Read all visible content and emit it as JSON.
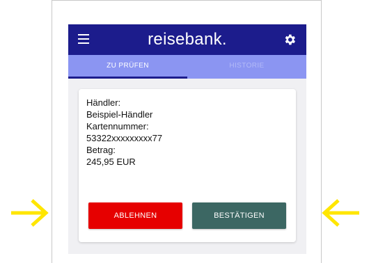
{
  "app": {
    "brand": "reisebank."
  },
  "tabs": [
    {
      "label": "ZU PRÜFEN",
      "active": true
    },
    {
      "label": "HISTORIE",
      "active": false
    }
  ],
  "transaction": {
    "merchant_label": "Händler:",
    "merchant_value": "Beispiel-Händler",
    "card_label": "Kartennummer:",
    "card_value": "53322xxxxxxxxx77",
    "amount_label": "Betrag:",
    "amount_value": "245,95 EUR"
  },
  "actions": {
    "reject_label": "ABLEHNEN",
    "confirm_label": "BESTÄTIGEN"
  },
  "icons": {
    "menu": "hamburger-menu-icon",
    "settings": "gear-icon",
    "left_arrow": "arrow-right-icon",
    "right_arrow": "arrow-left-icon"
  },
  "colors": {
    "appbar": "#1c1c8c",
    "tabbar": "#8b95f2",
    "reject": "#e60000",
    "confirm": "#3c6763",
    "arrows": "#ffe600"
  }
}
